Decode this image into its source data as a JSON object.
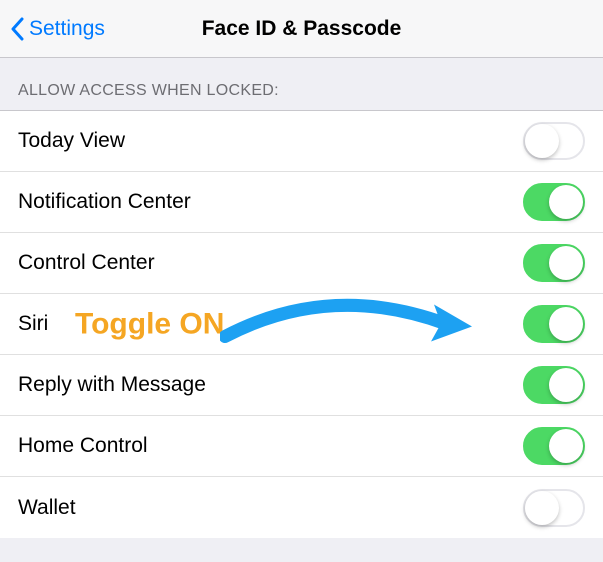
{
  "nav": {
    "back_label": "Settings",
    "title": "Face ID & Passcode"
  },
  "section_header": "ALLOW ACCESS WHEN LOCKED:",
  "rows": [
    {
      "label": "Today View",
      "on": false
    },
    {
      "label": "Notification Center",
      "on": true
    },
    {
      "label": "Control Center",
      "on": true
    },
    {
      "label": "Siri",
      "on": true
    },
    {
      "label": "Reply with Message",
      "on": true
    },
    {
      "label": "Home Control",
      "on": true
    },
    {
      "label": "Wallet",
      "on": false
    }
  ],
  "annotation": {
    "text": "Toggle ON",
    "color": "#f5a623",
    "arrow_color": "#1da1f2"
  }
}
